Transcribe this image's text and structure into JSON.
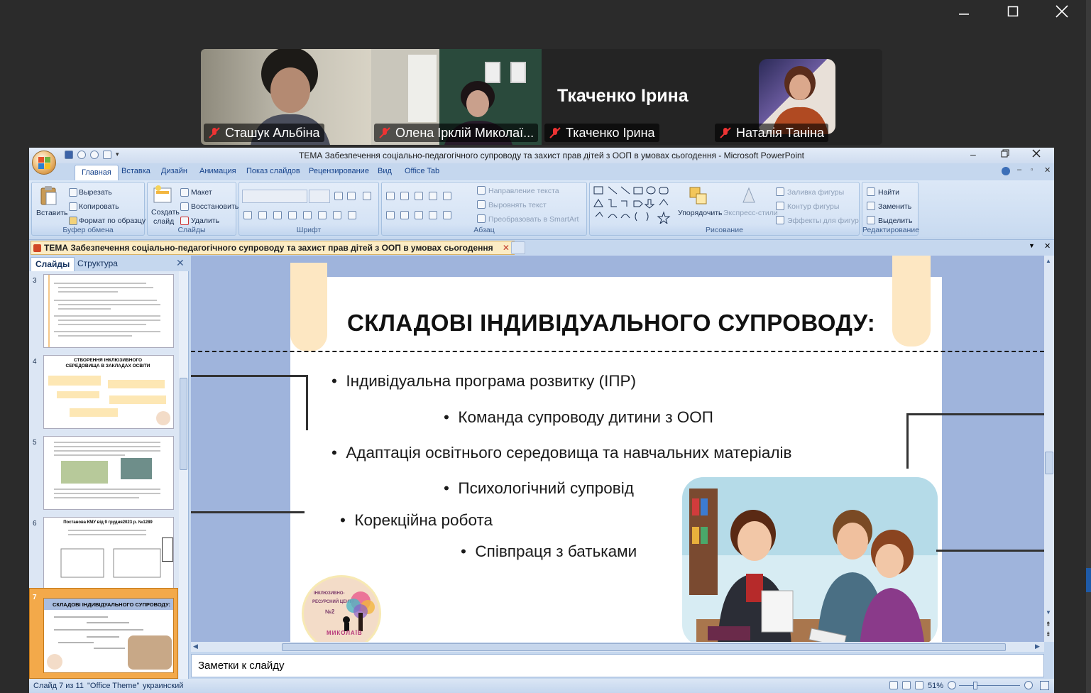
{
  "meeting": {
    "participants": [
      {
        "name": "Сташук Альбіна"
      },
      {
        "name": "Олена Ірклій Миколаї..."
      },
      {
        "name": "Ткаченко Ірина",
        "display_label": "Ткаченко Ірина"
      },
      {
        "name": "Наталія Таніна"
      }
    ]
  },
  "ppt": {
    "title": "ТЕМА Забезпечення соціально-педагогічного супроводу та захист прав дітей з ООП в умовах сьогодення  - Microsoft PowerPoint",
    "tabs": [
      "Главная",
      "Вставка",
      "Дизайн",
      "Анимация",
      "Показ слайдов",
      "Рецензирование",
      "Вид",
      "Office Tab"
    ],
    "ribbon": {
      "clipboard": {
        "paste": "Вставить",
        "cut": "Вырезать",
        "copy": "Копировать",
        "format": "Формат по образцу",
        "label": "Буфер обмена"
      },
      "slides": {
        "new": "Создать",
        "new2": "слайд",
        "layout": "Макет",
        "reset": "Восстановить",
        "delete": "Удалить",
        "label": "Слайды"
      },
      "font": {
        "label": "Шрифт"
      },
      "paragraph": {
        "dir": "Направление текста",
        "align": "Выровнять текст",
        "smartart": "Преобразовать в SmartArt",
        "label": "Абзац"
      },
      "drawing": {
        "arrange": "Упорядочить",
        "styles": "Экспресс-стили",
        "fill": "Заливка фигуры",
        "outline": "Контур фигуры",
        "effects": "Эффекты для фигур",
        "label": "Рисование"
      },
      "editing": {
        "find": "Найти",
        "replace": "Заменить",
        "select": "Выделить",
        "label": "Редактирование"
      }
    },
    "doc_tab": "ТЕМА Забезпечення соціально-педагогічного супроводу та захист прав дітей з ООП в умовах сьогодення",
    "pane_tabs": {
      "slides": "Слайды",
      "outline": "Структура"
    },
    "thumbnails": [
      {
        "num": "3",
        "title": ""
      },
      {
        "num": "4",
        "title": "СТВОРЕННЯ ІНКЛЮЗИВНОГО СЕРЕДОВИЩА В ЗАКЛАДАХ ОСВІТИ"
      },
      {
        "num": "5",
        "title": ""
      },
      {
        "num": "6",
        "title": "Постанова КМУ від 9 грудня2023 р. №1289"
      },
      {
        "num": "7",
        "title": "СКЛАДОВІ ІНДИВІДУАЛЬНОГО СУПРОВОДУ:"
      }
    ],
    "slide": {
      "title": "СКЛАДОВІ ІНДИВІДУАЛЬНОГО СУПРОВОДУ:",
      "bullets": [
        "Індивідуальна програма розвитку (ІПР)",
        "Команда супроводу дитини з ООП",
        "Адаптація освітнього середовища та навчальних матеріалів",
        "Психологічний супровід",
        "Корекційна робота",
        "Співпраця з батьками"
      ],
      "logo": {
        "line1": "ІНКЛЮЗИВНО-",
        "line2": "РЕСУРСНИЙ ЦЕНТР",
        "line3": "№2",
        "city": "МИКОЛАЇВ"
      }
    },
    "notes": "Заметки к слайду",
    "status": {
      "slide": "Слайд 7 из 11",
      "theme": "\"Office Theme\"",
      "lang": "украинский",
      "zoom": "51%"
    }
  }
}
